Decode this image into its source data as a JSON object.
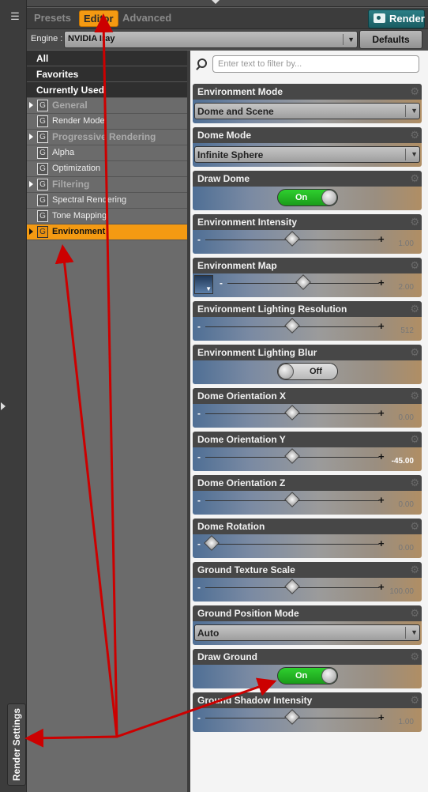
{
  "tabs": [
    {
      "label": "Presets",
      "active": false
    },
    {
      "label": "Editor",
      "active": true
    },
    {
      "label": "Advanced",
      "active": false
    }
  ],
  "render_button": {
    "label": "Render",
    "icon": "camera-icon"
  },
  "engine": {
    "label": "Engine :",
    "value": "NVIDIA Iray",
    "defaults_label": "Defaults"
  },
  "side_tab": {
    "label": "Render Settings"
  },
  "tree": {
    "headers": [
      "All",
      "Favorites",
      "Currently Used"
    ],
    "items": [
      {
        "label": "General",
        "expandable": true,
        "group": true
      },
      {
        "label": "Render Mode",
        "expandable": false,
        "group": false
      },
      {
        "label": "Progressive Rendering",
        "expandable": true,
        "group": true
      },
      {
        "label": "Alpha",
        "expandable": false,
        "group": false
      },
      {
        "label": "Optimization",
        "expandable": false,
        "group": false
      },
      {
        "label": "Filtering",
        "expandable": true,
        "group": true
      },
      {
        "label": "Spectral Rendering",
        "expandable": false,
        "group": false
      },
      {
        "label": "Tone Mapping",
        "expandable": false,
        "group": false
      },
      {
        "label": "Environment",
        "expandable": true,
        "group": false,
        "selected": true
      }
    ],
    "item_icon": "G"
  },
  "filter": {
    "placeholder": "Enter text to filter by..."
  },
  "properties": [
    {
      "name": "Environment Mode",
      "type": "combo",
      "value": "Dome and Scene"
    },
    {
      "name": "Dome Mode",
      "type": "combo",
      "value": "Infinite Sphere"
    },
    {
      "name": "Draw Dome",
      "type": "toggle",
      "value": "On"
    },
    {
      "name": "Environment Intensity",
      "type": "slider",
      "value": "1.00",
      "level": 0.5
    },
    {
      "name": "Environment Map",
      "type": "map",
      "value": "2.00",
      "level": 0.5
    },
    {
      "name": "Environment Lighting Resolution",
      "type": "slider",
      "value": "512",
      "level": 0.5
    },
    {
      "name": "Environment Lighting Blur",
      "type": "toggle",
      "value": "Off"
    },
    {
      "name": "Dome Orientation X",
      "type": "slider",
      "value": "0.00",
      "level": 0.5
    },
    {
      "name": "Dome Orientation Y",
      "type": "slider",
      "value": "-45.00",
      "level": 0.5
    },
    {
      "name": "Dome Orientation Z",
      "type": "slider",
      "value": "0.00",
      "level": 0.5
    },
    {
      "name": "Dome Rotation",
      "type": "slider",
      "value": "0.00",
      "level": 0.0
    },
    {
      "name": "Ground Texture Scale",
      "type": "slider",
      "value": "100.00",
      "level": 0.5
    },
    {
      "name": "Ground Position Mode",
      "type": "combo",
      "value": "Auto"
    },
    {
      "name": "Draw Ground",
      "type": "toggle",
      "value": "On"
    },
    {
      "name": "Ground Shadow Intensity",
      "type": "slider",
      "value": "1.00",
      "level": 0.5
    }
  ],
  "colors": {
    "accent": "#f49a12",
    "render": "#1f6d74",
    "annotation": "#cc0000"
  }
}
